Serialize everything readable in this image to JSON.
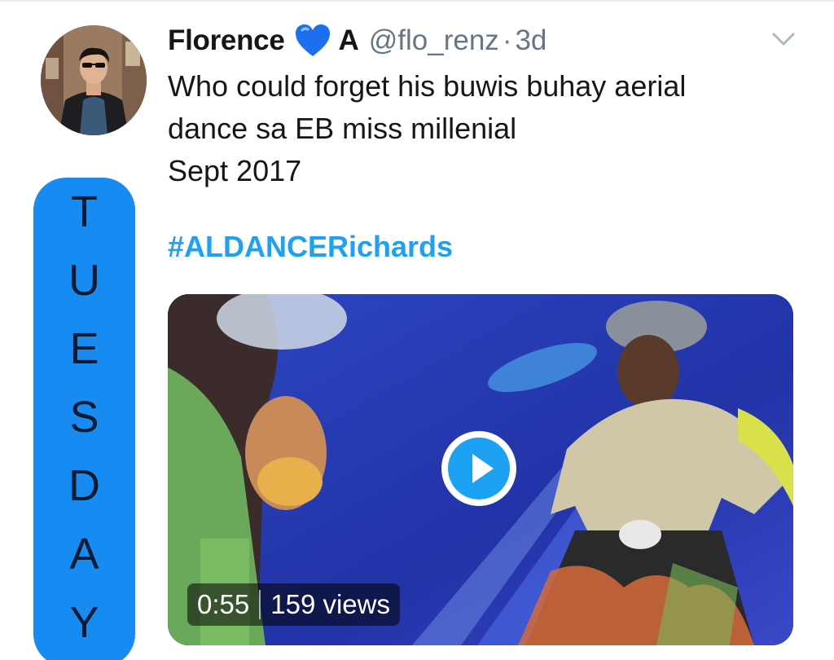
{
  "tweet": {
    "display_name": "Florence",
    "name_suffix": "A",
    "handle": "@flo_renz",
    "separator": "·",
    "time": "3d",
    "text_lines": [
      "Who could forget his buwis buhay aerial",
      "dance sa EB miss millenial",
      "Sept 2017"
    ],
    "hashtag": "#ALDANCERichards"
  },
  "video": {
    "duration": "0:55",
    "views": "159 views"
  },
  "side_banner": {
    "letters": [
      "T",
      "U",
      "E",
      "S",
      "D",
      "A",
      "Y"
    ],
    "color": "#168cf2"
  },
  "colors": {
    "hashtag": "#1da1f2",
    "heart": "#1d6ff2",
    "secondary_text": "#657786"
  },
  "icons": {
    "heart": "blue-heart-icon",
    "chevron": "chevron-down-icon",
    "play": "play-icon"
  }
}
